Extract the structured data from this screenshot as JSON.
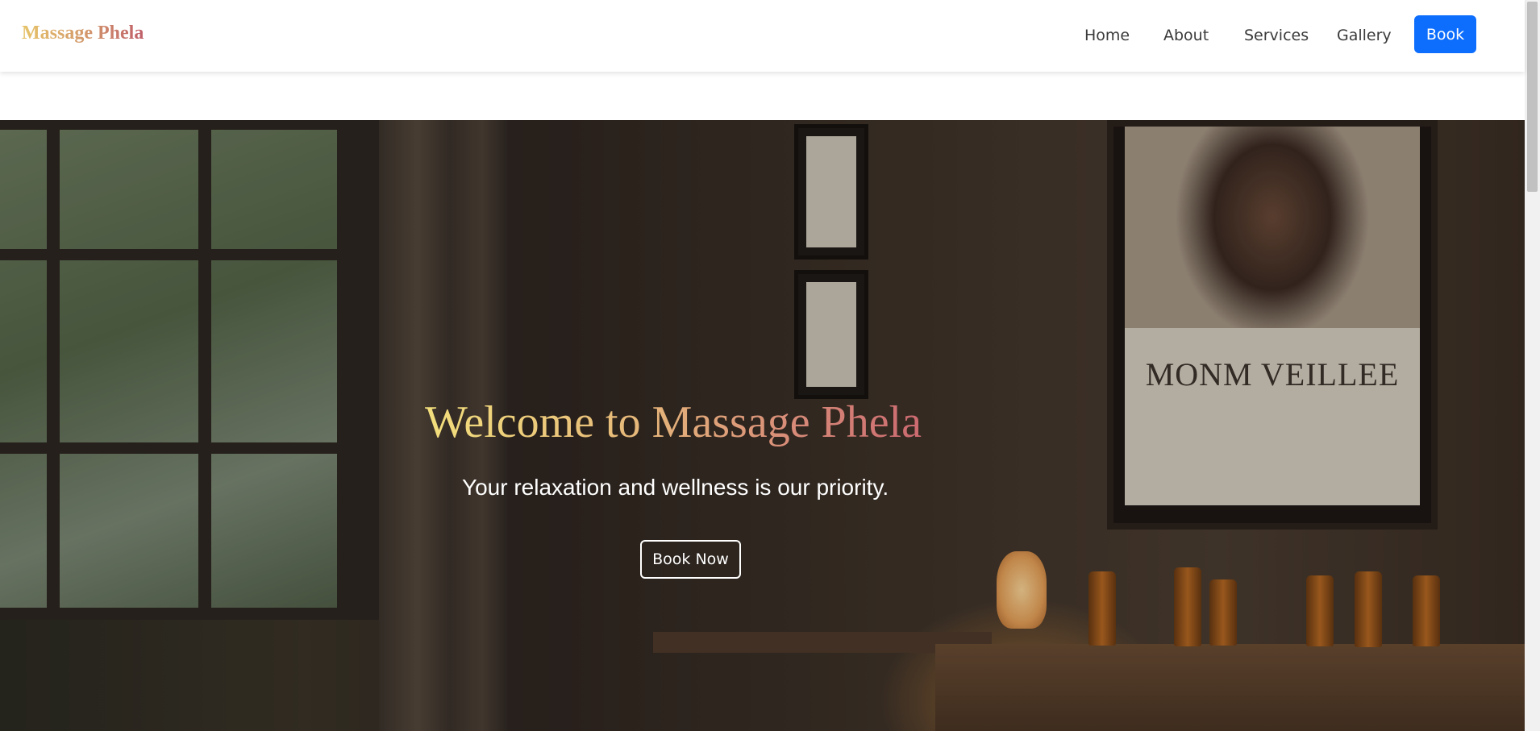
{
  "navbar": {
    "brand": "Massage Phela",
    "links": [
      {
        "label": "Home"
      },
      {
        "label": "About"
      },
      {
        "label": "Services"
      },
      {
        "label": "Gallery"
      }
    ],
    "cta_label": "Book",
    "cta_color": "#0d6efd"
  },
  "hero": {
    "title": "Welcome to Massage Phela",
    "subtitle": "Your relaxation and wellness is our priority.",
    "button_label": "Book Now",
    "poster_text": "MONM VEILLEE",
    "title_gradient": [
      "#f3df7c",
      "#e6b87a",
      "#d78a78",
      "#c8606e"
    ]
  }
}
